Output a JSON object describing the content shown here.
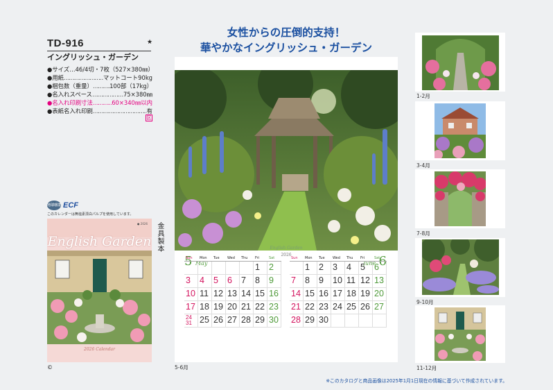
{
  "product": {
    "code": "TD-916",
    "star": "★",
    "name": "イングリッシュ・ガーデン",
    "specs": [
      {
        "key": "サイズ",
        "value": "46/4切・7枚（527×380㎜）",
        "highlight": false,
        "fill": false
      },
      {
        "key": "用紙",
        "value": "マットコート90kg",
        "highlight": false,
        "fill": true
      },
      {
        "key": "梱包数（重量）",
        "value": "100部（17kg）",
        "highlight": false,
        "fill": true
      },
      {
        "key": "名入れスペース",
        "value": "75×380㎜",
        "highlight": false,
        "fill": true
      },
      {
        "key": "名入れ印刷寸法",
        "value": "60×340㎜以内",
        "highlight": true,
        "fill": true
      },
      {
        "key": "表紙名入れ印刷",
        "value": "有",
        "highlight": false,
        "fill": true
      }
    ],
    "badge": "区"
  },
  "ecf": {
    "logo_text": "ECF",
    "mark_text": "地球環境",
    "note": "このカレンダーは無塩素漂白パルプを使用しています。"
  },
  "cover": {
    "title": "English Garden",
    "bottom": "2026 Calendar",
    "brand": "● 2026"
  },
  "side_label": "金具製本",
  "copyright": "©",
  "headline": {
    "line1": "女性からの圧倒的支持！",
    "line2": "華やかなイングリッシュ・ガーデン"
  },
  "calendar": {
    "caption": "English Garden",
    "year": "2026",
    "weekdays": [
      "Sun",
      "Mon",
      "Tue",
      "Wed",
      "Thu",
      "Fri",
      "Sat"
    ],
    "may": {
      "number": "5",
      "name": "May",
      "cells": [
        "",
        "",
        "",
        "",
        "",
        "1",
        "2",
        "3",
        "4",
        "5",
        "6",
        "7",
        "8",
        "9",
        "10",
        "11",
        "12",
        "13",
        "14",
        "15",
        "16",
        "17",
        "18",
        "19",
        "20",
        "21",
        "22",
        "23",
        "24/31",
        "25",
        "26",
        "27",
        "28",
        "29",
        "30"
      ],
      "holidays": [
        "3",
        "4",
        "5",
        "6"
      ],
      "boxed": [
        "1",
        "2",
        "7",
        "8",
        "9",
        "10",
        "11",
        "12",
        "13",
        "14",
        "15",
        "16",
        "17",
        "18",
        "19",
        "20",
        "21",
        "22",
        "23",
        "24/31",
        "25",
        "26",
        "27",
        "28",
        "29",
        "30",
        "4",
        "5",
        "6"
      ]
    },
    "june": {
      "number": "6",
      "name": "June",
      "cells": [
        "",
        "1",
        "2",
        "3",
        "4",
        "5",
        "6",
        "7",
        "8",
        "9",
        "10",
        "11",
        "12",
        "13",
        "14",
        "15",
        "16",
        "17",
        "18",
        "19",
        "20",
        "21",
        "22",
        "23",
        "24",
        "25",
        "26",
        "27",
        "28",
        "29",
        "30",
        "",
        "",
        "",
        ""
      ],
      "holidays": [],
      "boxed": [
        "1",
        "2",
        "3",
        "4",
        "5",
        "6",
        "7",
        "8",
        "9",
        "10",
        "11",
        "12",
        "13",
        "14",
        "15",
        "16",
        "17",
        "18",
        "19",
        "20",
        "21",
        "22",
        "23",
        "24",
        "25",
        "26",
        "27",
        "28",
        "29",
        "30"
      ]
    }
  },
  "main_caption": "5-6月",
  "thumbnails": [
    {
      "label": "1-2月"
    },
    {
      "label": "3-4月"
    },
    {
      "label": "7-8月"
    },
    {
      "label": "9-10月"
    },
    {
      "label": "11-12月"
    }
  ],
  "footnote": "※このカタログと商品画像は2025年1月1日現在の情報に基づいて作成されています。",
  "colors": {
    "accent_blue": "#1a4fa0",
    "pink": "#e4007f",
    "green": "#4f9a3a",
    "holiday_red": "#d3135e"
  }
}
